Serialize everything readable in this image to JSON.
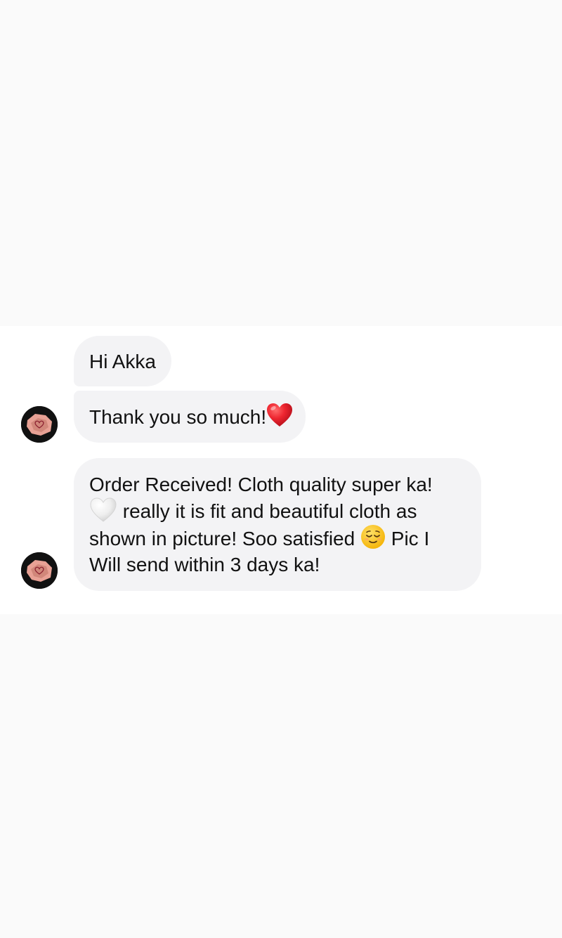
{
  "conversation": {
    "messages": [
      {
        "text": "Hi Akka"
      },
      {
        "text": "Thank you so much!",
        "emoji": "red-heart"
      },
      {
        "part1": "Order Received! Cloth quality super ka!",
        "emoji1": "white-heart",
        "part2": " really it is fit and beautiful cloth as shown in picture! Soo satisfied ",
        "emoji2": "relieved-face",
        "part3": " Pic I Will send within 3 days ka!"
      }
    ]
  },
  "avatar": {
    "icon": "pink-heart-photo-avatar"
  },
  "colors": {
    "bubble_bg": "#f3f3f5",
    "panel_bg": "#ffffff",
    "page_bg": "#fafafa",
    "heart_red": "#e8202e"
  }
}
